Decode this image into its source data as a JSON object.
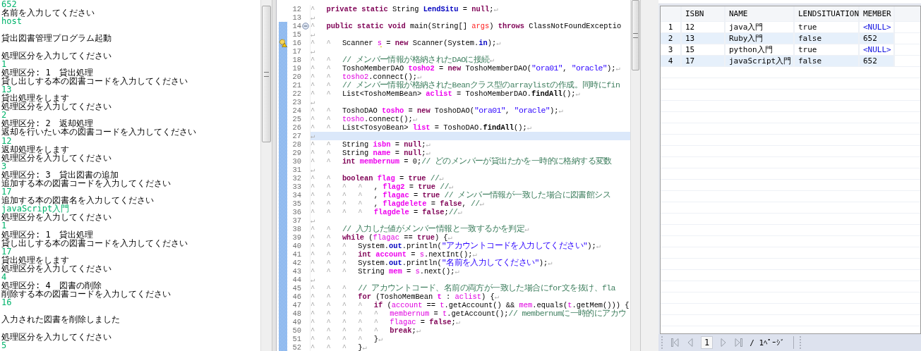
{
  "console": {
    "lines": [
      {
        "text": "652",
        "kind": "input"
      },
      {
        "text": "名前を入力してください",
        "kind": "output"
      },
      {
        "text": "host",
        "kind": "input"
      },
      {
        "kind": "blank"
      },
      {
        "text": "貸出図書管理プログラム起動",
        "kind": "output"
      },
      {
        "kind": "blank"
      },
      {
        "text": "処理区分を入力してください",
        "kind": "output"
      },
      {
        "text": "1",
        "kind": "input"
      },
      {
        "text": "処理区分: 1　貸出処理",
        "kind": "output"
      },
      {
        "text": "貸し出しする本の図書コードを入力してください",
        "kind": "output"
      },
      {
        "text": "13",
        "kind": "input"
      },
      {
        "text": "貸出処理をします",
        "kind": "output"
      },
      {
        "text": "処理区分を入力してください",
        "kind": "output"
      },
      {
        "text": "2",
        "kind": "input"
      },
      {
        "text": "処理区分: 2　返却処理",
        "kind": "output"
      },
      {
        "text": "返却を行いたい本の図書コードを入力してください",
        "kind": "output"
      },
      {
        "text": "12",
        "kind": "input"
      },
      {
        "text": "返却処理をします",
        "kind": "output"
      },
      {
        "text": "処理区分を入力してください",
        "kind": "output"
      },
      {
        "text": "3",
        "kind": "input"
      },
      {
        "text": "処理区分: 3　貸出図書の追加",
        "kind": "output"
      },
      {
        "text": "追加する本の図書コードを入力してください",
        "kind": "output"
      },
      {
        "text": "17",
        "kind": "input"
      },
      {
        "text": "追加する本の図書名を入力してください",
        "kind": "output"
      },
      {
        "text": "javaScript入門",
        "kind": "input"
      },
      {
        "text": "処理区分を入力してください",
        "kind": "output"
      },
      {
        "text": "1",
        "kind": "input"
      },
      {
        "text": "処理区分: 1　貸出処理",
        "kind": "output"
      },
      {
        "text": "貸し出しする本の図書コードを入力してください",
        "kind": "output"
      },
      {
        "text": "17",
        "kind": "input"
      },
      {
        "text": "貸出処理をします",
        "kind": "output"
      },
      {
        "text": "処理区分を入力してください",
        "kind": "output"
      },
      {
        "text": "4",
        "kind": "input"
      },
      {
        "text": "処理区分: 4　図書の削除",
        "kind": "output"
      },
      {
        "text": "削除する本の図書コードを入力してください",
        "kind": "output"
      },
      {
        "text": "16",
        "kind": "input"
      },
      {
        "kind": "blank"
      },
      {
        "text": "入力された図書を削除しました",
        "kind": "output"
      },
      {
        "kind": "blank"
      },
      {
        "text": "処理区分を入力してください",
        "kind": "output"
      },
      {
        "text": "5",
        "kind": "input"
      }
    ]
  },
  "editor": {
    "lines": [
      {
        "number": "12",
        "kind": "code",
        "current": false,
        "range": false,
        "tabs": "^",
        "segments": [
          {
            "kind": "kw",
            "text": "private static"
          },
          {
            "kind": "plain",
            "text": " String "
          },
          {
            "kind": "sfield",
            "text": "LendSitu"
          },
          {
            "kind": "plain",
            "text": " = "
          },
          {
            "kind": "kw",
            "text": "null"
          },
          {
            "kind": "plain",
            "text": ";"
          }
        ],
        "eol": "↵"
      },
      {
        "number": "13",
        "kind": "code",
        "current": false,
        "range": false,
        "eol": "↵"
      },
      {
        "number": "14",
        "kind": "fold",
        "current": false,
        "range": true,
        "tabs": "^",
        "segments": [
          {
            "kind": "kw",
            "text": "public static void"
          },
          {
            "kind": "plain",
            "text": " main(String[] "
          },
          {
            "kind": "param",
            "text": "args"
          },
          {
            "kind": "plain",
            "text": ") "
          },
          {
            "kind": "kw",
            "text": "throws"
          },
          {
            "kind": "plain",
            "text": " ClassNotFoundExceptio"
          }
        ]
      },
      {
        "number": "15",
        "kind": "code",
        "current": false,
        "range": true,
        "eol": "↵"
      },
      {
        "number": "16",
        "kind": "warning",
        "current": false,
        "range": true,
        "tabs": "^^",
        "segments": [
          {
            "kind": "plain",
            "text": "Scanner "
          },
          {
            "kind": "varwarn",
            "text": "s"
          },
          {
            "kind": "plain",
            "text": " = "
          },
          {
            "kind": "kw",
            "text": "new"
          },
          {
            "kind": "plain",
            "text": " Scanner(System."
          },
          {
            "kind": "sfield",
            "text": "in"
          },
          {
            "kind": "plain",
            "text": ");"
          }
        ],
        "eol": "↵"
      },
      {
        "number": "17",
        "kind": "code",
        "current": false,
        "range": true,
        "eol": "↵"
      },
      {
        "number": "18",
        "kind": "code",
        "current": false,
        "range": true,
        "tabs": "^^",
        "segments": [
          {
            "kind": "comment",
            "text": "// メンバー情報が格納されたDAOに接続"
          }
        ],
        "eol": "↵"
      },
      {
        "number": "19",
        "kind": "code",
        "current": false,
        "range": true,
        "tabs": "^^",
        "segments": [
          {
            "kind": "plain",
            "text": "ToshoMemberDAO "
          },
          {
            "kind": "decl",
            "text": "tosho2"
          },
          {
            "kind": "plain",
            "text": " = "
          },
          {
            "kind": "kw",
            "text": "new"
          },
          {
            "kind": "plain",
            "text": " ToshoMemberDAO("
          },
          {
            "kind": "string",
            "text": "\"ora01\""
          },
          {
            "kind": "plain",
            "text": ", "
          },
          {
            "kind": "string",
            "text": "\"oracle\""
          },
          {
            "kind": "plain",
            "text": ");"
          }
        ],
        "eol": "↵"
      },
      {
        "number": "20",
        "kind": "code",
        "current": false,
        "range": true,
        "tabs": "^^",
        "segments": [
          {
            "kind": "var",
            "text": "tosho2"
          },
          {
            "kind": "plain",
            "text": ".connect();"
          }
        ],
        "eol": "↵"
      },
      {
        "number": "21",
        "kind": "code",
        "current": false,
        "range": true,
        "tabs": "^^",
        "segments": [
          {
            "kind": "comment",
            "text": "// メンバー情報が格納されたBeanクラス型のarraylistの作成。同時にfin"
          }
        ]
      },
      {
        "number": "22",
        "kind": "code",
        "current": false,
        "range": true,
        "tabs": "^^",
        "segments": [
          {
            "kind": "plain",
            "text": "List<ToshoMemBean> "
          },
          {
            "kind": "decl",
            "text": "aclist"
          },
          {
            "kind": "plain",
            "text": " = ToshoMemberDAO."
          },
          {
            "kind": "smethod",
            "text": "findAll"
          },
          {
            "kind": "plain",
            "text": "();"
          }
        ],
        "eol": "↵"
      },
      {
        "number": "23",
        "kind": "code",
        "current": false,
        "range": true,
        "eol": "↵"
      },
      {
        "number": "24",
        "kind": "code",
        "current": false,
        "range": true,
        "tabs": "^^",
        "segments": [
          {
            "kind": "plain",
            "text": "ToshoDAO "
          },
          {
            "kind": "decl",
            "text": "tosho"
          },
          {
            "kind": "plain",
            "text": " = "
          },
          {
            "kind": "kw",
            "text": "new"
          },
          {
            "kind": "plain",
            "text": " ToshoDAO("
          },
          {
            "kind": "string",
            "text": "\"ora01\""
          },
          {
            "kind": "plain",
            "text": ", "
          },
          {
            "kind": "string",
            "text": "\"oracle\""
          },
          {
            "kind": "plain",
            "text": ");"
          }
        ],
        "eol": "↵"
      },
      {
        "number": "25",
        "kind": "code",
        "current": false,
        "range": true,
        "tabs": "^^",
        "segments": [
          {
            "kind": "var",
            "text": "tosho"
          },
          {
            "kind": "plain",
            "text": ".connect();"
          }
        ],
        "eol": "↵"
      },
      {
        "number": "26",
        "kind": "code",
        "current": false,
        "range": true,
        "tabs": "^^",
        "segments": [
          {
            "kind": "plain",
            "text": "List<TosyoBean> "
          },
          {
            "kind": "decl",
            "text": "list"
          },
          {
            "kind": "plain",
            "text": " = ToshoDAO."
          },
          {
            "kind": "smethod",
            "text": "findAll"
          },
          {
            "kind": "plain",
            "text": "();"
          }
        ],
        "eol": "↵"
      },
      {
        "number": "27",
        "kind": "code",
        "current": true,
        "range": true,
        "eol": "↵"
      },
      {
        "number": "28",
        "kind": "code",
        "current": false,
        "range": true,
        "tabs": "^^",
        "segments": [
          {
            "kind": "plain",
            "text": "String "
          },
          {
            "kind": "decl",
            "text": "isbn"
          },
          {
            "kind": "plain",
            "text": " = "
          },
          {
            "kind": "kw",
            "text": "null"
          },
          {
            "kind": "plain",
            "text": ";"
          }
        ],
        "eol": "↵"
      },
      {
        "number": "29",
        "kind": "code",
        "current": false,
        "range": true,
        "tabs": "^^",
        "segments": [
          {
            "kind": "plain",
            "text": "String "
          },
          {
            "kind": "decl",
            "text": "name"
          },
          {
            "kind": "plain",
            "text": " = "
          },
          {
            "kind": "kw",
            "text": "null"
          },
          {
            "kind": "plain",
            "text": ";"
          }
        ],
        "eol": "↵"
      },
      {
        "number": "30",
        "kind": "code",
        "current": false,
        "range": true,
        "tabs": "^^",
        "segments": [
          {
            "kind": "kw",
            "text": "int "
          },
          {
            "kind": "decl",
            "text": "membernum"
          },
          {
            "kind": "plain",
            "text": " = 0;"
          },
          {
            "kind": "comment",
            "text": "// どのメンバーが貸出たかを一時的に格納する変数"
          }
        ]
      },
      {
        "number": "31",
        "kind": "code",
        "current": false,
        "range": true,
        "eol": "↵"
      },
      {
        "number": "32",
        "kind": "code",
        "current": false,
        "range": true,
        "tabs": "^^",
        "segments": [
          {
            "kind": "kw",
            "text": "boolean "
          },
          {
            "kind": "decl",
            "text": "flag"
          },
          {
            "kind": "plain",
            "text": " = "
          },
          {
            "kind": "kw",
            "text": "true "
          },
          {
            "kind": "comment",
            "text": "//"
          }
        ],
        "eol": "↵"
      },
      {
        "number": "33",
        "kind": "code",
        "current": false,
        "range": true,
        "tabs": "^^^^",
        "segments": [
          {
            "kind": "plain",
            "text": ", "
          },
          {
            "kind": "decl",
            "text": "flag2"
          },
          {
            "kind": "plain",
            "text": " = "
          },
          {
            "kind": "kw",
            "text": "true "
          },
          {
            "kind": "comment",
            "text": "//"
          }
        ],
        "eol": "↵"
      },
      {
        "number": "34",
        "kind": "code",
        "current": false,
        "range": true,
        "tabs": "^^^^",
        "segments": [
          {
            "kind": "plain",
            "text": ", "
          },
          {
            "kind": "decl",
            "text": "flagac"
          },
          {
            "kind": "plain",
            "text": " = "
          },
          {
            "kind": "kw",
            "text": "true "
          },
          {
            "kind": "comment",
            "text": "// メンバー情報が一致した場合に図書館シス"
          }
        ]
      },
      {
        "number": "35",
        "kind": "code",
        "current": false,
        "range": true,
        "tabs": "^^^^",
        "segments": [
          {
            "kind": "plain",
            "text": ", "
          },
          {
            "kind": "decl",
            "text": "flagdelete"
          },
          {
            "kind": "plain",
            "text": " = "
          },
          {
            "kind": "kw",
            "text": "false"
          },
          {
            "kind": "plain",
            "text": ", "
          },
          {
            "kind": "comment",
            "text": "//"
          }
        ],
        "eol": "↵"
      },
      {
        "number": "36",
        "kind": "code",
        "current": false,
        "range": true,
        "tabs": "^^^^",
        "segments": [
          {
            "kind": "decl",
            "text": "flagdele"
          },
          {
            "kind": "plain",
            "text": " = "
          },
          {
            "kind": "kw",
            "text": "false"
          },
          {
            "kind": "plain",
            "text": ";"
          },
          {
            "kind": "comment",
            "text": "//"
          }
        ],
        "eol": "↵"
      },
      {
        "number": "37",
        "kind": "code",
        "current": false,
        "range": true,
        "eol": "↵"
      },
      {
        "number": "38",
        "kind": "code",
        "current": false,
        "range": true,
        "tabs": "^^",
        "segments": [
          {
            "kind": "comment",
            "text": "// 入力した値がメンバー情報と一致するかを判定"
          }
        ],
        "eol": "↵"
      },
      {
        "number": "39",
        "kind": "code",
        "current": false,
        "range": true,
        "tabs": "^^",
        "segments": [
          {
            "kind": "kw",
            "text": "while"
          },
          {
            "kind": "plain",
            "text": " ("
          },
          {
            "kind": "var",
            "text": "flagac"
          },
          {
            "kind": "plain",
            "text": " == "
          },
          {
            "kind": "kw",
            "text": "true"
          },
          {
            "kind": "plain",
            "text": ") {"
          }
        ],
        "eol": "↵"
      },
      {
        "number": "40",
        "kind": "code",
        "current": false,
        "range": true,
        "tabs": "^^^",
        "segments": [
          {
            "kind": "plain",
            "text": "System."
          },
          {
            "kind": "sfield",
            "text": "out"
          },
          {
            "kind": "plain",
            "text": ".println("
          },
          {
            "kind": "string",
            "text": "\"アカウントコードを入力してください\""
          },
          {
            "kind": "plain",
            "text": ");"
          }
        ],
        "eol": "↵"
      },
      {
        "number": "41",
        "kind": "code",
        "current": false,
        "range": true,
        "tabs": "^^^",
        "segments": [
          {
            "kind": "kw",
            "text": "int "
          },
          {
            "kind": "decl",
            "text": "account"
          },
          {
            "kind": "plain",
            "text": " = "
          },
          {
            "kind": "var",
            "text": "s"
          },
          {
            "kind": "plain",
            "text": ".nextInt();"
          }
        ],
        "eol": "↵"
      },
      {
        "number": "42",
        "kind": "code",
        "current": false,
        "range": true,
        "tabs": "^^^",
        "segments": [
          {
            "kind": "plain",
            "text": "System."
          },
          {
            "kind": "sfield",
            "text": "out"
          },
          {
            "kind": "plain",
            "text": ".println("
          },
          {
            "kind": "string",
            "text": "\"名前を入力してください\""
          },
          {
            "kind": "plain",
            "text": ");"
          }
        ],
        "eol": "↵"
      },
      {
        "number": "43",
        "kind": "code",
        "current": false,
        "range": true,
        "tabs": "^^^",
        "segments": [
          {
            "kind": "plain",
            "text": "String "
          },
          {
            "kind": "decl",
            "text": "mem"
          },
          {
            "kind": "plain",
            "text": " = "
          },
          {
            "kind": "var",
            "text": "s"
          },
          {
            "kind": "plain",
            "text": ".next();"
          }
        ],
        "eol": "↵"
      },
      {
        "number": "44",
        "kind": "code",
        "current": false,
        "range": true,
        "eol": "↵"
      },
      {
        "number": "45",
        "kind": "code",
        "current": false,
        "range": true,
        "tabs": "^^^",
        "segments": [
          {
            "kind": "comment",
            "text": "// アカウントコード、名前の両方が一致した場合にfor文を抜け、fla"
          }
        ]
      },
      {
        "number": "46",
        "kind": "code",
        "current": false,
        "range": true,
        "tabs": "^^^",
        "segments": [
          {
            "kind": "kw",
            "text": "for"
          },
          {
            "kind": "plain",
            "text": " (ToshoMemBean "
          },
          {
            "kind": "decl",
            "text": "t"
          },
          {
            "kind": "plain",
            "text": " : "
          },
          {
            "kind": "var",
            "text": "aclist"
          },
          {
            "kind": "plain",
            "text": ") {"
          }
        ],
        "eol": "↵"
      },
      {
        "number": "47",
        "kind": "code",
        "current": false,
        "range": true,
        "tabs": "^^^^",
        "segments": [
          {
            "kind": "kw",
            "text": "if"
          },
          {
            "kind": "plain",
            "text": " ("
          },
          {
            "kind": "var",
            "text": "account"
          },
          {
            "kind": "plain",
            "text": " == "
          },
          {
            "kind": "var",
            "text": "t"
          },
          {
            "kind": "plain",
            "text": ".getAccount() && "
          },
          {
            "kind": "var",
            "text": "mem"
          },
          {
            "kind": "plain",
            "text": ".equals("
          },
          {
            "kind": "var",
            "text": "t"
          },
          {
            "kind": "plain",
            "text": ".getMem())) {"
          }
        ]
      },
      {
        "number": "48",
        "kind": "code",
        "current": false,
        "range": true,
        "tabs": "^^^^^",
        "segments": [
          {
            "kind": "var",
            "text": "membernum"
          },
          {
            "kind": "plain",
            "text": " = "
          },
          {
            "kind": "var",
            "text": "t"
          },
          {
            "kind": "plain",
            "text": ".getAccount();"
          },
          {
            "kind": "comment",
            "text": "// membernumに一時的にアカウ"
          }
        ]
      },
      {
        "number": "49",
        "kind": "code",
        "current": false,
        "range": true,
        "tabs": "^^^^^",
        "segments": [
          {
            "kind": "var",
            "text": "flagac"
          },
          {
            "kind": "plain",
            "text": " = "
          },
          {
            "kind": "kw",
            "text": "false"
          },
          {
            "kind": "plain",
            "text": ";"
          }
        ],
        "eol": "↵"
      },
      {
        "number": "50",
        "kind": "code",
        "current": false,
        "range": true,
        "tabs": "^^^^^",
        "segments": [
          {
            "kind": "kw",
            "text": "break"
          },
          {
            "kind": "plain",
            "text": ";"
          }
        ],
        "eol": "↵"
      },
      {
        "number": "51",
        "kind": "code",
        "current": false,
        "range": true,
        "tabs": "^^^^",
        "segments": [
          {
            "kind": "plain",
            "text": "}"
          }
        ],
        "eol": "↵"
      },
      {
        "number": "52",
        "kind": "code",
        "current": false,
        "range": true,
        "tabs": "^^^",
        "segments": [
          {
            "kind": "plain",
            "text": "}"
          }
        ],
        "eol": "↵"
      }
    ]
  },
  "result_table": {
    "columns": [
      "ISBN",
      "NAME",
      "LENDSITUATION",
      "MEMBER"
    ],
    "rows": [
      {
        "number": "1",
        "cells": [
          {
            "text": "12"
          },
          {
            "text": "java入門"
          },
          {
            "text": "true"
          },
          {
            "text": "<NULL>",
            "kind": "null"
          }
        ]
      },
      {
        "number": "2",
        "cells": [
          {
            "text": "13"
          },
          {
            "text": "Ruby入門"
          },
          {
            "text": "false"
          },
          {
            "text": "652"
          }
        ]
      },
      {
        "number": "3",
        "cells": [
          {
            "text": "15"
          },
          {
            "text": "python入門"
          },
          {
            "text": "true"
          },
          {
            "text": "<NULL>",
            "kind": "null"
          }
        ]
      },
      {
        "number": "4",
        "cells": [
          {
            "text": "17"
          },
          {
            "text": "javaScript入門"
          },
          {
            "text": "false"
          },
          {
            "text": "652"
          }
        ]
      }
    ]
  },
  "pager": {
    "page": "1",
    "total": "/ 1ﾍﾟｰｼﾞ"
  }
}
